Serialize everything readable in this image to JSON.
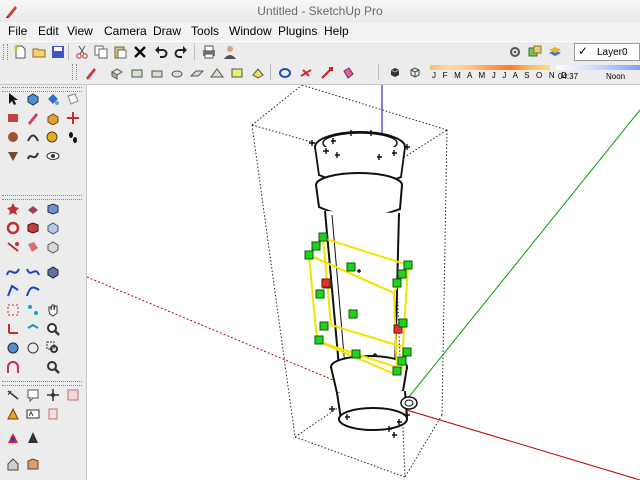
{
  "window": {
    "title": "Untitled - SketchUp Pro"
  },
  "menu": {
    "items": [
      "File",
      "Edit",
      "View",
      "Camera",
      "Draw",
      "Tools",
      "Window",
      "Plugins",
      "Help"
    ]
  },
  "toolbar": {
    "layer_name": "Layer0",
    "shadow_months": "J F M A M J J A S O N D",
    "shadow_time": "04:37",
    "shadow_time_label": "Noon"
  },
  "colors": {
    "selection_yellow": "#f3e400",
    "grip_green": "#1ed31e",
    "grip_red": "#e33030",
    "axis_red": "#c00000",
    "axis_green": "#00a000",
    "axis_blue": "#0000c8"
  }
}
